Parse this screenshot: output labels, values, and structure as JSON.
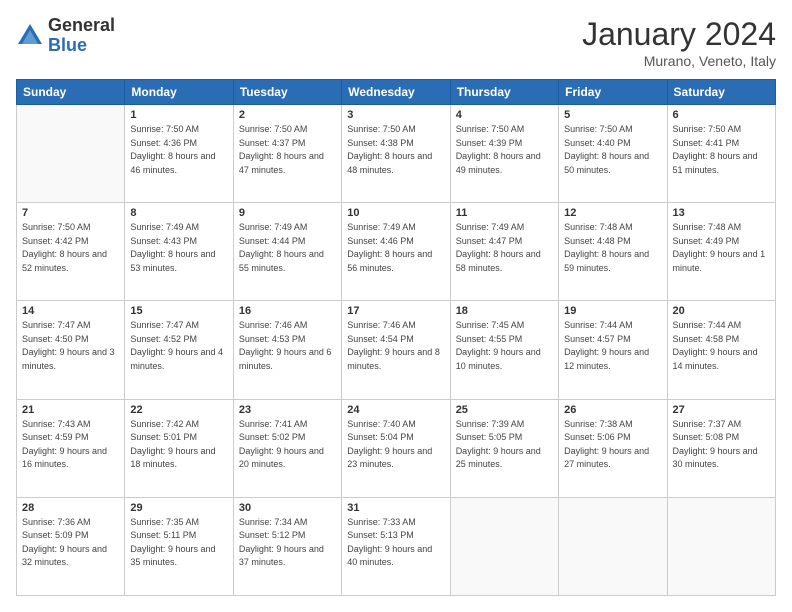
{
  "logo": {
    "general": "General",
    "blue": "Blue"
  },
  "header": {
    "month": "January 2024",
    "location": "Murano, Veneto, Italy"
  },
  "weekdays": [
    "Sunday",
    "Monday",
    "Tuesday",
    "Wednesday",
    "Thursday",
    "Friday",
    "Saturday"
  ],
  "weeks": [
    [
      {
        "day": "",
        "sunrise": "",
        "sunset": "",
        "daylight": ""
      },
      {
        "day": "1",
        "sunrise": "Sunrise: 7:50 AM",
        "sunset": "Sunset: 4:36 PM",
        "daylight": "Daylight: 8 hours and 46 minutes."
      },
      {
        "day": "2",
        "sunrise": "Sunrise: 7:50 AM",
        "sunset": "Sunset: 4:37 PM",
        "daylight": "Daylight: 8 hours and 47 minutes."
      },
      {
        "day": "3",
        "sunrise": "Sunrise: 7:50 AM",
        "sunset": "Sunset: 4:38 PM",
        "daylight": "Daylight: 8 hours and 48 minutes."
      },
      {
        "day": "4",
        "sunrise": "Sunrise: 7:50 AM",
        "sunset": "Sunset: 4:39 PM",
        "daylight": "Daylight: 8 hours and 49 minutes."
      },
      {
        "day": "5",
        "sunrise": "Sunrise: 7:50 AM",
        "sunset": "Sunset: 4:40 PM",
        "daylight": "Daylight: 8 hours and 50 minutes."
      },
      {
        "day": "6",
        "sunrise": "Sunrise: 7:50 AM",
        "sunset": "Sunset: 4:41 PM",
        "daylight": "Daylight: 8 hours and 51 minutes."
      }
    ],
    [
      {
        "day": "7",
        "sunrise": "Sunrise: 7:50 AM",
        "sunset": "Sunset: 4:42 PM",
        "daylight": "Daylight: 8 hours and 52 minutes."
      },
      {
        "day": "8",
        "sunrise": "Sunrise: 7:49 AM",
        "sunset": "Sunset: 4:43 PM",
        "daylight": "Daylight: 8 hours and 53 minutes."
      },
      {
        "day": "9",
        "sunrise": "Sunrise: 7:49 AM",
        "sunset": "Sunset: 4:44 PM",
        "daylight": "Daylight: 8 hours and 55 minutes."
      },
      {
        "day": "10",
        "sunrise": "Sunrise: 7:49 AM",
        "sunset": "Sunset: 4:46 PM",
        "daylight": "Daylight: 8 hours and 56 minutes."
      },
      {
        "day": "11",
        "sunrise": "Sunrise: 7:49 AM",
        "sunset": "Sunset: 4:47 PM",
        "daylight": "Daylight: 8 hours and 58 minutes."
      },
      {
        "day": "12",
        "sunrise": "Sunrise: 7:48 AM",
        "sunset": "Sunset: 4:48 PM",
        "daylight": "Daylight: 8 hours and 59 minutes."
      },
      {
        "day": "13",
        "sunrise": "Sunrise: 7:48 AM",
        "sunset": "Sunset: 4:49 PM",
        "daylight": "Daylight: 9 hours and 1 minute."
      }
    ],
    [
      {
        "day": "14",
        "sunrise": "Sunrise: 7:47 AM",
        "sunset": "Sunset: 4:50 PM",
        "daylight": "Daylight: 9 hours and 3 minutes."
      },
      {
        "day": "15",
        "sunrise": "Sunrise: 7:47 AM",
        "sunset": "Sunset: 4:52 PM",
        "daylight": "Daylight: 9 hours and 4 minutes."
      },
      {
        "day": "16",
        "sunrise": "Sunrise: 7:46 AM",
        "sunset": "Sunset: 4:53 PM",
        "daylight": "Daylight: 9 hours and 6 minutes."
      },
      {
        "day": "17",
        "sunrise": "Sunrise: 7:46 AM",
        "sunset": "Sunset: 4:54 PM",
        "daylight": "Daylight: 9 hours and 8 minutes."
      },
      {
        "day": "18",
        "sunrise": "Sunrise: 7:45 AM",
        "sunset": "Sunset: 4:55 PM",
        "daylight": "Daylight: 9 hours and 10 minutes."
      },
      {
        "day": "19",
        "sunrise": "Sunrise: 7:44 AM",
        "sunset": "Sunset: 4:57 PM",
        "daylight": "Daylight: 9 hours and 12 minutes."
      },
      {
        "day": "20",
        "sunrise": "Sunrise: 7:44 AM",
        "sunset": "Sunset: 4:58 PM",
        "daylight": "Daylight: 9 hours and 14 minutes."
      }
    ],
    [
      {
        "day": "21",
        "sunrise": "Sunrise: 7:43 AM",
        "sunset": "Sunset: 4:59 PM",
        "daylight": "Daylight: 9 hours and 16 minutes."
      },
      {
        "day": "22",
        "sunrise": "Sunrise: 7:42 AM",
        "sunset": "Sunset: 5:01 PM",
        "daylight": "Daylight: 9 hours and 18 minutes."
      },
      {
        "day": "23",
        "sunrise": "Sunrise: 7:41 AM",
        "sunset": "Sunset: 5:02 PM",
        "daylight": "Daylight: 9 hours and 20 minutes."
      },
      {
        "day": "24",
        "sunrise": "Sunrise: 7:40 AM",
        "sunset": "Sunset: 5:04 PM",
        "daylight": "Daylight: 9 hours and 23 minutes."
      },
      {
        "day": "25",
        "sunrise": "Sunrise: 7:39 AM",
        "sunset": "Sunset: 5:05 PM",
        "daylight": "Daylight: 9 hours and 25 minutes."
      },
      {
        "day": "26",
        "sunrise": "Sunrise: 7:38 AM",
        "sunset": "Sunset: 5:06 PM",
        "daylight": "Daylight: 9 hours and 27 minutes."
      },
      {
        "day": "27",
        "sunrise": "Sunrise: 7:37 AM",
        "sunset": "Sunset: 5:08 PM",
        "daylight": "Daylight: 9 hours and 30 minutes."
      }
    ],
    [
      {
        "day": "28",
        "sunrise": "Sunrise: 7:36 AM",
        "sunset": "Sunset: 5:09 PM",
        "daylight": "Daylight: 9 hours and 32 minutes."
      },
      {
        "day": "29",
        "sunrise": "Sunrise: 7:35 AM",
        "sunset": "Sunset: 5:11 PM",
        "daylight": "Daylight: 9 hours and 35 minutes."
      },
      {
        "day": "30",
        "sunrise": "Sunrise: 7:34 AM",
        "sunset": "Sunset: 5:12 PM",
        "daylight": "Daylight: 9 hours and 37 minutes."
      },
      {
        "day": "31",
        "sunrise": "Sunrise: 7:33 AM",
        "sunset": "Sunset: 5:13 PM",
        "daylight": "Daylight: 9 hours and 40 minutes."
      },
      {
        "day": "",
        "sunrise": "",
        "sunset": "",
        "daylight": ""
      },
      {
        "day": "",
        "sunrise": "",
        "sunset": "",
        "daylight": ""
      },
      {
        "day": "",
        "sunrise": "",
        "sunset": "",
        "daylight": ""
      }
    ]
  ]
}
